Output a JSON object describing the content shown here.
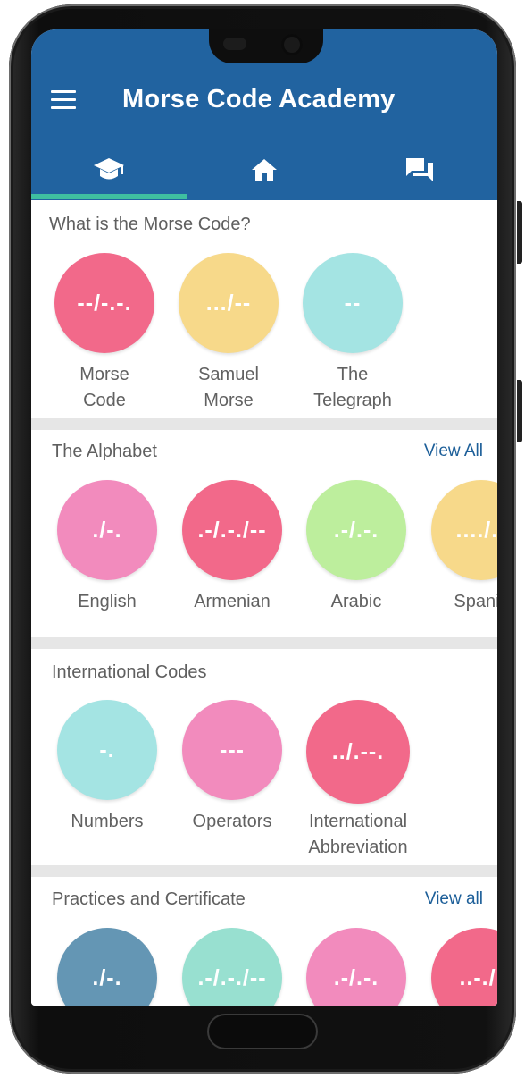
{
  "app": {
    "title": "Morse Code Academy",
    "tabs": [
      {
        "icon": "graduation-cap-icon",
        "active": true
      },
      {
        "icon": "home-icon",
        "active": false
      },
      {
        "icon": "chat-icon",
        "active": false
      }
    ]
  },
  "sections": [
    {
      "title": "What is the Morse Code?",
      "view_all": "",
      "items": [
        {
          "code": "--/-.-.",
          "label_line1": "Morse",
          "label_line2": "Code",
          "color": "#f2698a"
        },
        {
          "code": ".../--",
          "label_line1": "Samuel",
          "label_line2": "Morse",
          "color": "#f7d98a"
        },
        {
          "code": "--",
          "label_line1": "The",
          "label_line2": "Telegraph",
          "color": "#a4e4e3"
        }
      ]
    },
    {
      "title": "The Alphabet",
      "view_all": "View All",
      "items": [
        {
          "code": "./-.",
          "label_line1": "English",
          "label_line2": "",
          "color": "#f28bbd"
        },
        {
          "code": ".-/.-./--",
          "label_line1": "Armenian",
          "label_line2": "",
          "color": "#f2698a"
        },
        {
          "code": ".-/.-.",
          "label_line1": "Arabic",
          "label_line2": "",
          "color": "#bdee9d"
        },
        {
          "code": "..../.-",
          "label_line1": "Spanis",
          "label_line2": "",
          "color": "#f7d98a"
        }
      ]
    },
    {
      "title": "International Codes",
      "view_all": "",
      "items": [
        {
          "code": "-.",
          "label_line1": "Numbers",
          "label_line2": "",
          "color": "#a4e4e3"
        },
        {
          "code": "---",
          "label_line1": "Operators",
          "label_line2": "",
          "color": "#f28bbd"
        },
        {
          "code": "../.--.",
          "label_line1": "International",
          "label_line2": "Abbreviation",
          "color": "#f2698a"
        }
      ]
    },
    {
      "title": "Practices and Certificate",
      "view_all": "View all",
      "items": [
        {
          "code": "./-.",
          "label_line1": "",
          "label_line2": "",
          "color": "#6496b4"
        },
        {
          "code": ".-/.-./--",
          "label_line1": "",
          "label_line2": "",
          "color": "#98e0d0"
        },
        {
          "code": ".-/.-.",
          "label_line1": "",
          "label_line2": "",
          "color": "#f28bbd"
        },
        {
          "code": "..-./.",
          "label_line1": "",
          "label_line2": "",
          "color": "#f2698a"
        }
      ]
    }
  ],
  "colors": {
    "appbar": "#2163a0",
    "tab_indicator": "#3fbfa0",
    "link": "#1d5f99"
  }
}
